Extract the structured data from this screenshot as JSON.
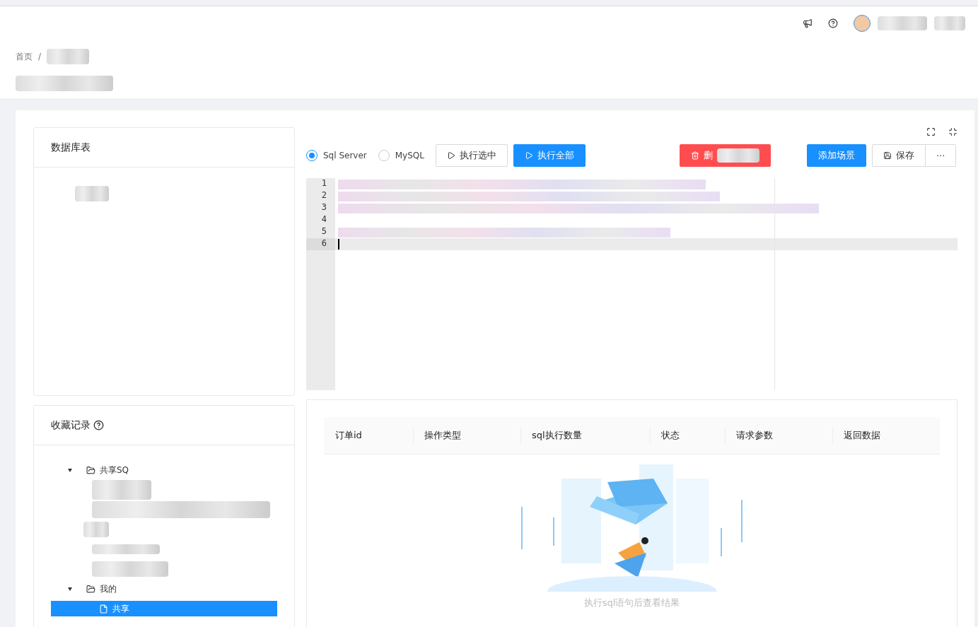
{
  "breadcrumb": [
    {
      "label": "首页",
      "separator": "/"
    }
  ],
  "db_panel": {
    "title": "数据库表"
  },
  "favorites": {
    "title": "收藏记录",
    "tree": [
      {
        "label": "共享SQ",
        "kind": "folder",
        "expanded": true,
        "selected": false
      },
      {
        "label": "我的",
        "kind": "folder",
        "expanded": true,
        "selected": false,
        "children": [
          {
            "label": "共享",
            "kind": "file",
            "selected": true
          }
        ]
      }
    ]
  },
  "db_types": [
    {
      "label": "Sql Server",
      "selected": true
    },
    {
      "label": "MySQL",
      "selected": false
    }
  ],
  "toolbar": [
    {
      "label": "执行选中",
      "kind": "plain"
    },
    {
      "label": "执行全部",
      "kind": "primary"
    },
    {
      "label": "删",
      "kind": "danger"
    },
    {
      "label": "添加场景",
      "kind": "primary"
    },
    {
      "label": "保存",
      "kind": "save"
    },
    {
      "label": "···",
      "kind": "more"
    }
  ],
  "editor": {
    "lines": [
      {
        "number": "1",
        "active": false
      },
      {
        "number": "2",
        "active": false
      },
      {
        "number": "3",
        "active": false
      },
      {
        "number": "4",
        "active": false
      },
      {
        "number": "5",
        "active": false
      },
      {
        "number": "6",
        "active": true
      }
    ]
  },
  "results": {
    "columns": [
      "订单id",
      "操作类型",
      "sql执行数量",
      "状态",
      "请求参数",
      "返回数据"
    ],
    "empty_text": "执行sql语句后查看结果"
  }
}
